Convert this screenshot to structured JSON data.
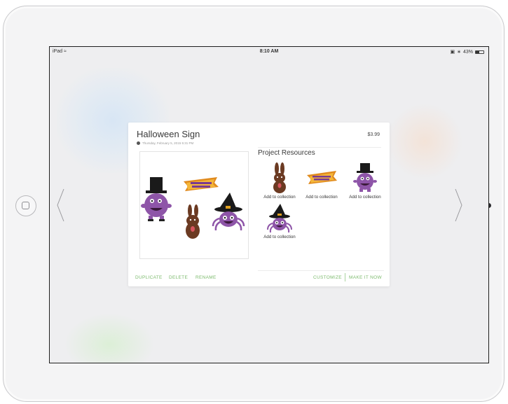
{
  "status_bar": {
    "device": "iPad",
    "time": "8:10 AM",
    "battery_text": "43%",
    "battery_level": 0.43
  },
  "card": {
    "title": "Halloween Sign",
    "price": "$3.99",
    "date": "Thursday, February 5, 2015 5:31 PM",
    "resources_title": "Project Resources",
    "resources": [
      {
        "label": "Add to collection",
        "icon": "chocolate-bunny"
      },
      {
        "label": "Add to collection",
        "icon": "happy-halloween-banner"
      },
      {
        "label": "Add to collection",
        "icon": "purple-monster-top-hat"
      },
      {
        "label": "Add to collection",
        "icon": "purple-spider-witch-hat"
      }
    ],
    "footer": {
      "duplicate": "DUPLICATE",
      "delete": "DELETE",
      "rename": "RENAME",
      "customize": "CUSTOMIZE",
      "make_it_now": "MAKE IT NOW"
    }
  },
  "colors": {
    "accent_green": "#7dbb6e",
    "monster_purple": "#8e55a8",
    "chocolate": "#6b3a22"
  }
}
